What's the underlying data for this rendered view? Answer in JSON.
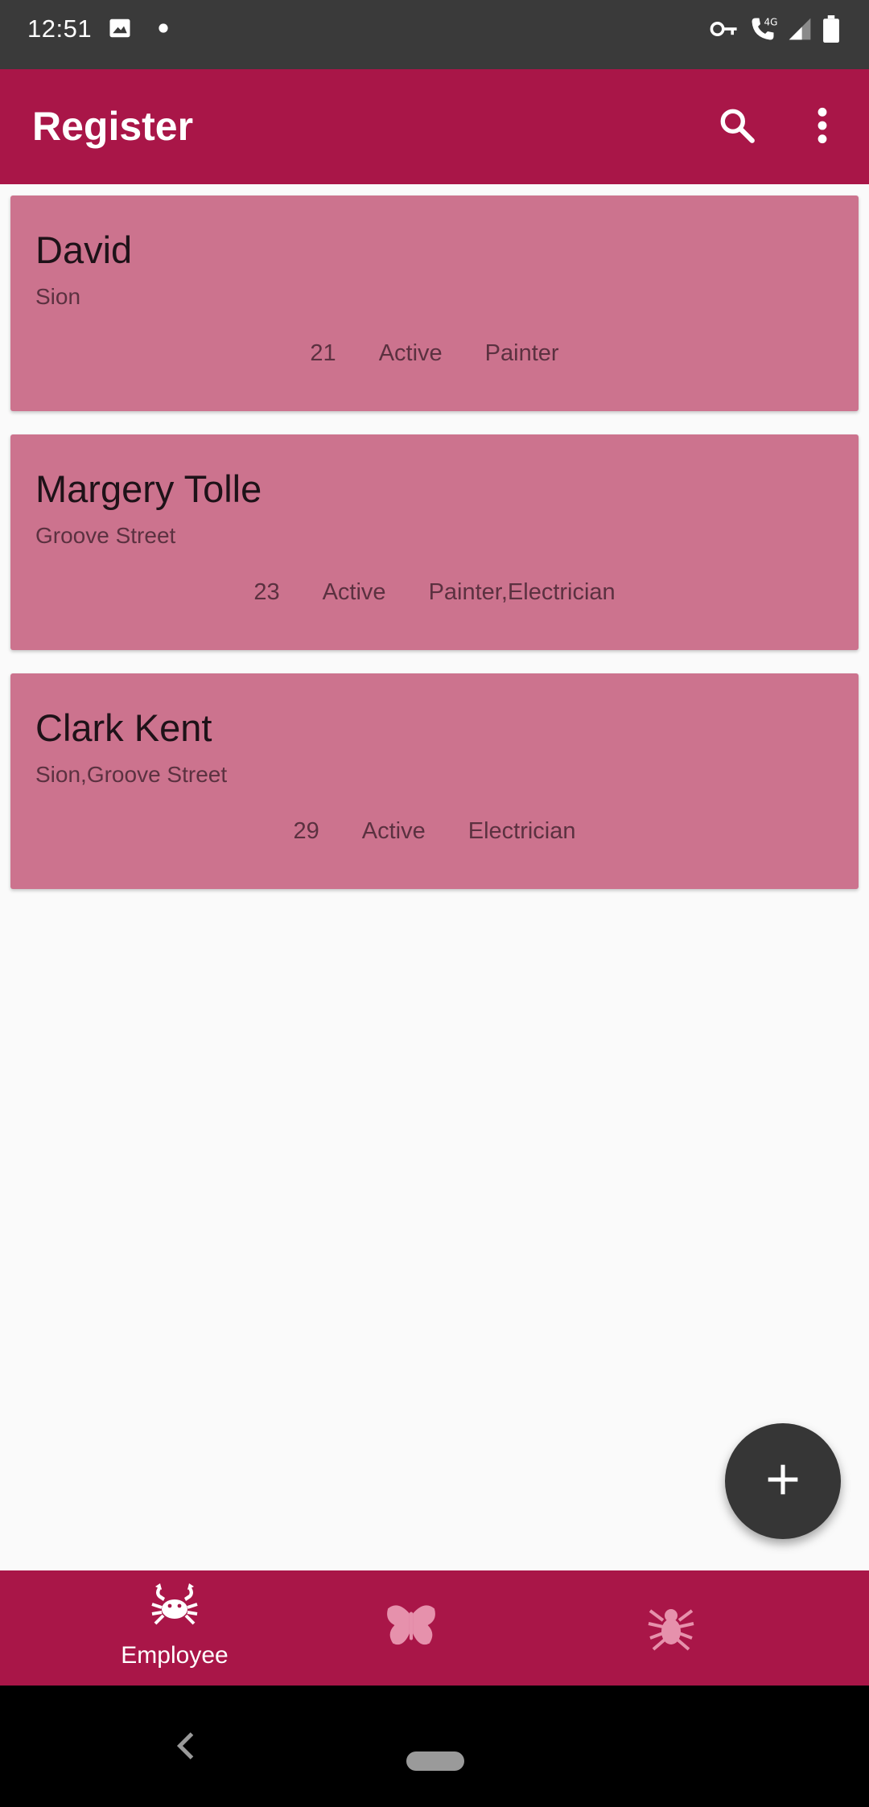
{
  "status_bar": {
    "time": "12:51",
    "icons": [
      "image-icon",
      "dot-icon",
      "vpn-key-icon",
      "wifi-calling-icon",
      "signal-icon",
      "battery-icon"
    ],
    "network": "4G"
  },
  "app_bar": {
    "title": "Register",
    "search_icon": "search-icon",
    "more_icon": "more-vert-icon",
    "color": "#a91648"
  },
  "employees": [
    {
      "name": "David",
      "address": "Sion",
      "age": "21",
      "status": "Active",
      "role": "Painter"
    },
    {
      "name": "Margery Tolle",
      "address": "Groove Street",
      "age": "23",
      "status": "Active",
      "role": "Painter,Electrician"
    },
    {
      "name": "Clark Kent",
      "address": "Sion,Groove Street",
      "age": "29",
      "status": "Active",
      "role": "Electrician"
    }
  ],
  "fab": {
    "icon": "plus-icon"
  },
  "bottom_nav": {
    "items": [
      {
        "label": "Employee",
        "icon": "crab-icon",
        "active": true
      },
      {
        "label": "",
        "icon": "butterfly-icon",
        "active": false
      },
      {
        "label": "",
        "icon": "spider-icon",
        "active": false
      }
    ]
  },
  "colors": {
    "accent": "#a91648",
    "card": "#cc738e",
    "fab": "#363636"
  }
}
